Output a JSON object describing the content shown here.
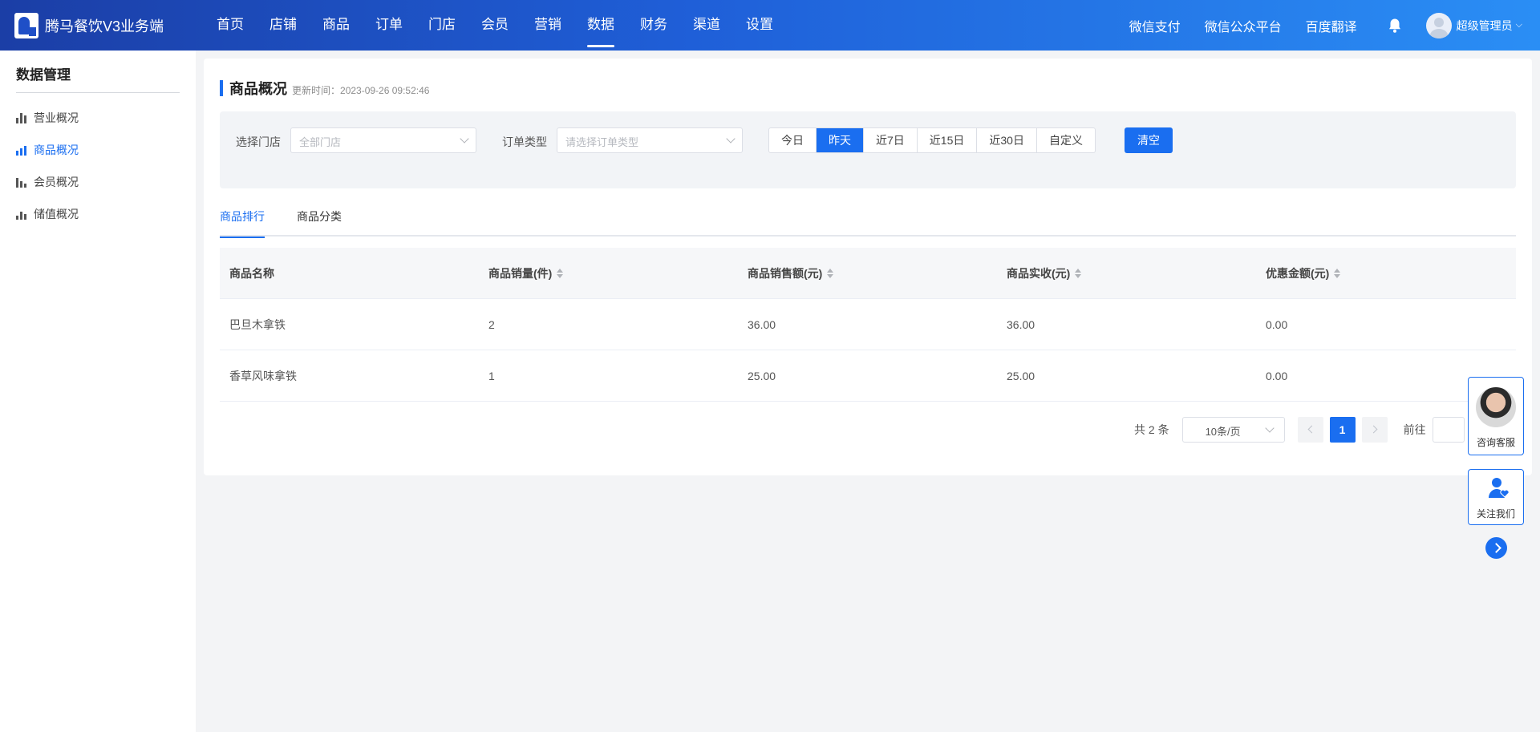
{
  "app": {
    "title": "腾马餐饮V3业务端"
  },
  "mainnav": {
    "items": [
      "首页",
      "店铺",
      "商品",
      "订单",
      "门店",
      "会员",
      "营销",
      "数据",
      "财务",
      "渠道",
      "设置"
    ],
    "active": "数据"
  },
  "rightnav": {
    "wechat_pay": "微信支付",
    "wechat_mp": "微信公众平台",
    "baidu_translate": "百度翻译",
    "user_name": "超级管理员",
    "user_caret": "⌵"
  },
  "sidebar": {
    "title": "数据管理",
    "items": [
      {
        "label": "营业概况",
        "icon": "bar-chart-icon"
      },
      {
        "label": "商品概况",
        "icon": "bar-chart-icon",
        "active": true
      },
      {
        "label": "会员概况",
        "icon": "bar-chart-icon"
      },
      {
        "label": "储值概况",
        "icon": "bar-chart-icon"
      }
    ]
  },
  "page": {
    "title": "商品概况",
    "update_label": "更新时间：",
    "update_time": "2023-09-26 09:52:46"
  },
  "filters": {
    "store_label": "选择门店",
    "store_placeholder": "全部门店",
    "order_type_label": "订单类型",
    "order_type_placeholder": "请选择订单类型",
    "date_ranges": [
      "今日",
      "昨天",
      "近7日",
      "近15日",
      "近30日",
      "自定义"
    ],
    "active_range": "昨天",
    "clear_label": "清空"
  },
  "tabs": [
    {
      "label": "商品排行",
      "active": true
    },
    {
      "label": "商品分类",
      "active": false
    }
  ],
  "table": {
    "columns": [
      "商品名称",
      "商品销量(件)",
      "商品销售额(元)",
      "商品实收(元)",
      "优惠金额(元)"
    ],
    "rows": [
      [
        "巴旦木拿铁",
        "2",
        "36.00",
        "36.00",
        "0.00"
      ],
      [
        "香草风味拿铁",
        "1",
        "25.00",
        "25.00",
        "0.00"
      ]
    ]
  },
  "pagination": {
    "total_text": "共 2 条",
    "page_size": "10条/页",
    "current_page": "1",
    "goto_label": "前往"
  },
  "floating": {
    "service_label": "咨询客服",
    "follow_label": "关注我们"
  },
  "colors": {
    "primary": "#1a6ef0",
    "header_gradient_start": "#1b3ea6",
    "header_gradient_end": "#2a8ef5",
    "page_bg": "#f3f4f6"
  }
}
